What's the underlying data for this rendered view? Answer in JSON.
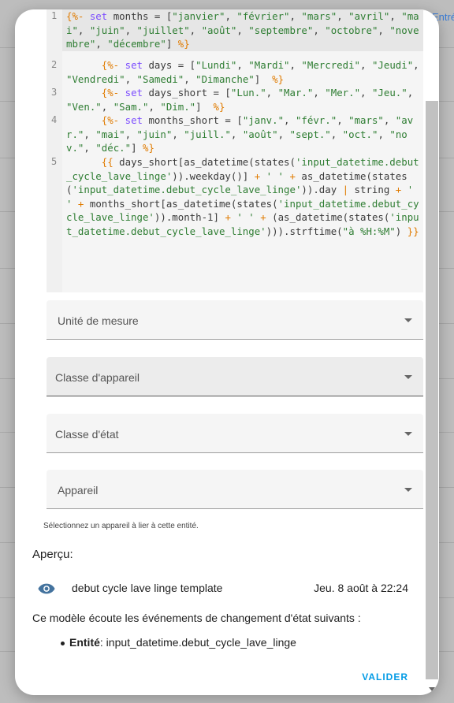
{
  "background": {
    "tab_label": "Entré"
  },
  "code_editor": {
    "lines": [
      {
        "number": "1",
        "tokens": [
          {
            "t": "{%- ",
            "c": "dl"
          },
          {
            "t": "set",
            "c": "kw"
          },
          {
            "t": " months = [",
            "c": "plain"
          },
          {
            "t": "\"janvier\"",
            "c": "st"
          },
          {
            "t": ", ",
            "c": "plain"
          },
          {
            "t": "\"février\"",
            "c": "st"
          },
          {
            "t": ", ",
            "c": "plain"
          },
          {
            "t": "\"mars\"",
            "c": "st"
          },
          {
            "t": ", ",
            "c": "plain"
          },
          {
            "t": "\"avril\"",
            "c": "st"
          },
          {
            "t": ", ",
            "c": "plain"
          },
          {
            "t": "\"mai\"",
            "c": "st"
          },
          {
            "t": ", ",
            "c": "plain"
          },
          {
            "t": "\"juin\"",
            "c": "st"
          },
          {
            "t": ", ",
            "c": "plain"
          },
          {
            "t": "\"juillet\"",
            "c": "st"
          },
          {
            "t": ", ",
            "c": "plain"
          },
          {
            "t": "\"août\"",
            "c": "st"
          },
          {
            "t": ", ",
            "c": "plain"
          },
          {
            "t": "\"septembre\"",
            "c": "st"
          },
          {
            "t": ", ",
            "c": "plain"
          },
          {
            "t": "\"octobre\"",
            "c": "st"
          },
          {
            "t": ", ",
            "c": "plain"
          },
          {
            "t": "\"novembre\"",
            "c": "st"
          },
          {
            "t": ", ",
            "c": "plain"
          },
          {
            "t": "\"décembre\"",
            "c": "st"
          },
          {
            "t": "] ",
            "c": "plain"
          },
          {
            "t": "%}",
            "c": "dl"
          }
        ]
      },
      {
        "number": "2",
        "tokens": [
          {
            "t": "      {%- ",
            "c": "dl"
          },
          {
            "t": "set",
            "c": "kw"
          },
          {
            "t": " days = [",
            "c": "plain"
          },
          {
            "t": "\"Lundi\"",
            "c": "st"
          },
          {
            "t": ", ",
            "c": "plain"
          },
          {
            "t": "\"Mardi\"",
            "c": "st"
          },
          {
            "t": ", ",
            "c": "plain"
          },
          {
            "t": "\"Mercredi\"",
            "c": "st"
          },
          {
            "t": ", ",
            "c": "plain"
          },
          {
            "t": "\"Jeudi\"",
            "c": "st"
          },
          {
            "t": ", ",
            "c": "plain"
          },
          {
            "t": "\"Vendredi\"",
            "c": "st"
          },
          {
            "t": ", ",
            "c": "plain"
          },
          {
            "t": "\"Samedi\"",
            "c": "st"
          },
          {
            "t": ", ",
            "c": "plain"
          },
          {
            "t": "\"Dimanche\"",
            "c": "st"
          },
          {
            "t": "]  ",
            "c": "plain"
          },
          {
            "t": "%}",
            "c": "dl"
          }
        ]
      },
      {
        "number": "3",
        "tokens": [
          {
            "t": "      {%- ",
            "c": "dl"
          },
          {
            "t": "set",
            "c": "kw"
          },
          {
            "t": " days_short = [",
            "c": "plain"
          },
          {
            "t": "\"Lun.\"",
            "c": "st"
          },
          {
            "t": ", ",
            "c": "plain"
          },
          {
            "t": "\"Mar.\"",
            "c": "st"
          },
          {
            "t": ", ",
            "c": "plain"
          },
          {
            "t": "\"Mer.\"",
            "c": "st"
          },
          {
            "t": ", ",
            "c": "plain"
          },
          {
            "t": "\"Jeu.\"",
            "c": "st"
          },
          {
            "t": ", ",
            "c": "plain"
          },
          {
            "t": "\"Ven.\"",
            "c": "st"
          },
          {
            "t": ", ",
            "c": "plain"
          },
          {
            "t": "\"Sam.\"",
            "c": "st"
          },
          {
            "t": ", ",
            "c": "plain"
          },
          {
            "t": "\"Dim.\"",
            "c": "st"
          },
          {
            "t": "]  ",
            "c": "plain"
          },
          {
            "t": "%}",
            "c": "dl"
          }
        ]
      },
      {
        "number": "4",
        "tokens": [
          {
            "t": "      {%- ",
            "c": "dl"
          },
          {
            "t": "set",
            "c": "kw"
          },
          {
            "t": " months_short = [",
            "c": "plain"
          },
          {
            "t": "\"janv.\"",
            "c": "st"
          },
          {
            "t": ", ",
            "c": "plain"
          },
          {
            "t": "\"févr.\"",
            "c": "st"
          },
          {
            "t": ", ",
            "c": "plain"
          },
          {
            "t": "\"mars\"",
            "c": "st"
          },
          {
            "t": ", ",
            "c": "plain"
          },
          {
            "t": "\"avr.\"",
            "c": "st"
          },
          {
            "t": ", ",
            "c": "plain"
          },
          {
            "t": "\"mai\"",
            "c": "st"
          },
          {
            "t": ", ",
            "c": "plain"
          },
          {
            "t": "\"juin\"",
            "c": "st"
          },
          {
            "t": ", ",
            "c": "plain"
          },
          {
            "t": "\"juill.\"",
            "c": "st"
          },
          {
            "t": ", ",
            "c": "plain"
          },
          {
            "t": "\"août\"",
            "c": "st"
          },
          {
            "t": ", ",
            "c": "plain"
          },
          {
            "t": "\"sept.\"",
            "c": "st"
          },
          {
            "t": ", ",
            "c": "plain"
          },
          {
            "t": "\"oct.\"",
            "c": "st"
          },
          {
            "t": ", ",
            "c": "plain"
          },
          {
            "t": "\"nov.\"",
            "c": "st"
          },
          {
            "t": ", ",
            "c": "plain"
          },
          {
            "t": "\"déc.\"",
            "c": "st"
          },
          {
            "t": "] ",
            "c": "plain"
          },
          {
            "t": "%}",
            "c": "dl"
          }
        ]
      },
      {
        "number": "5",
        "tokens": [
          {
            "t": "      {{ ",
            "c": "dl"
          },
          {
            "t": "days_short[as_datetime(states(",
            "c": "plain"
          },
          {
            "t": "'input_datetime.debut_cycle_lave_linge'",
            "c": "st"
          },
          {
            "t": ")).weekday()] ",
            "c": "plain"
          },
          {
            "t": "+ ",
            "c": "dl"
          },
          {
            "t": "' '",
            "c": "st"
          },
          {
            "t": " + ",
            "c": "dl"
          },
          {
            "t": "as_datetime(states(",
            "c": "plain"
          },
          {
            "t": "'input_datetime.debut_cycle_lave_linge'",
            "c": "st"
          },
          {
            "t": ")).day ",
            "c": "plain"
          },
          {
            "t": "| ",
            "c": "dl"
          },
          {
            "t": "string ",
            "c": "plain"
          },
          {
            "t": "+ ",
            "c": "dl"
          },
          {
            "t": "' '",
            "c": "st"
          },
          {
            "t": " + ",
            "c": "dl"
          },
          {
            "t": "months_short[as_datetime(states(",
            "c": "plain"
          },
          {
            "t": "'input_datetime.debut_cycle_lave_linge'",
            "c": "st"
          },
          {
            "t": ")).month-1] ",
            "c": "plain"
          },
          {
            "t": "+ ",
            "c": "dl"
          },
          {
            "t": "' '",
            "c": "st"
          },
          {
            "t": " + ",
            "c": "dl"
          },
          {
            "t": "(as_datetime(states(",
            "c": "plain"
          },
          {
            "t": "'input_datetime.debut_cycle_lave_linge'",
            "c": "st"
          },
          {
            "t": "))).strftime(",
            "c": "plain"
          },
          {
            "t": "\"à %H:%M\"",
            "c": "st"
          },
          {
            "t": ") ",
            "c": "plain"
          },
          {
            "t": "}}",
            "c": "dl"
          }
        ]
      }
    ]
  },
  "fields": {
    "unit": {
      "label": "Unité de mesure"
    },
    "device_class": {
      "label": "Classe d'appareil"
    },
    "state_class": {
      "label": "Classe d'état"
    },
    "device": {
      "label": "Appareil",
      "helper": "Sélectionnez un appareil à lier à cette entité."
    }
  },
  "preview": {
    "title": "Aperçu:",
    "entity_name": "debut cycle lave linge template",
    "entity_state": "Jeu. 8 août à 22:24",
    "icon": "eye-icon",
    "listen_text": "Ce modèle écoute les événements de changement d'état suivants :",
    "listener_label": "Entité",
    "listener_value": ": input_datetime.debut_cycle_lave_linge"
  },
  "actions": {
    "submit_label": "VALIDER"
  },
  "colors": {
    "accent": "#039be5",
    "keyword": "#7c4dff",
    "string": "#2e7d32",
    "delimiter": "#e07b00"
  }
}
